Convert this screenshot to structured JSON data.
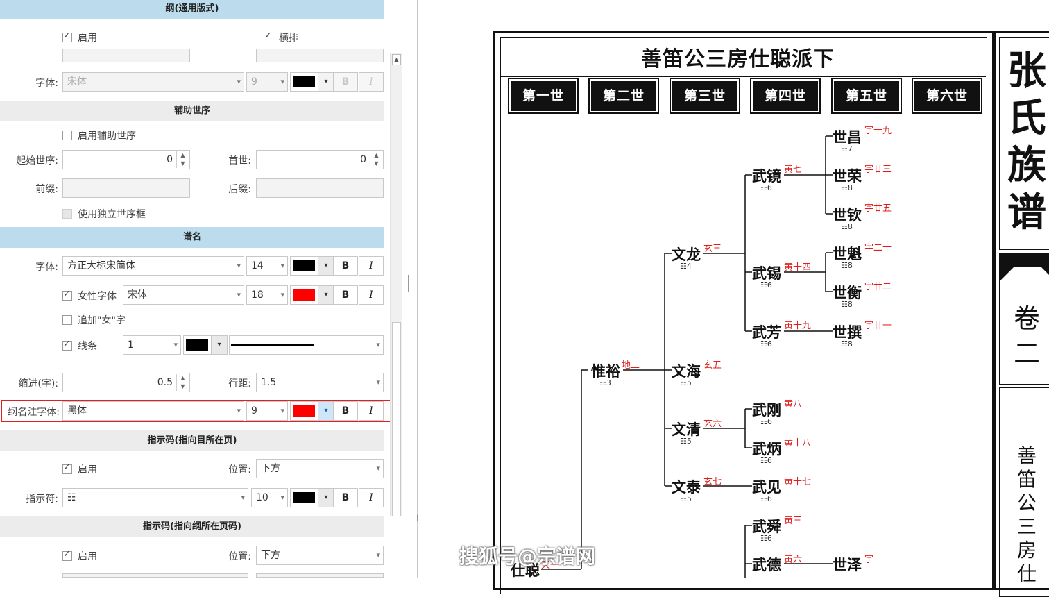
{
  "settings_panel": {
    "section_outline": "纲(通用版式)",
    "outline_enabled_label": "启用",
    "outline_horizontal_label": "横排",
    "outline_font_label": "字体:",
    "outline_font_value": "宋体",
    "outline_font_size": "9",
    "section_aux_gen": "辅助世序",
    "aux_enable_label": "启用辅助世序",
    "start_gen_label": "起始世序:",
    "start_gen_value": "0",
    "first_gen_label": "首世:",
    "first_gen_value": "0",
    "prefix_label": "前缀:",
    "suffix_label": "后缀:",
    "independent_box_label": "使用独立世序框",
    "section_name": "谱名",
    "name_font_label": "字体:",
    "name_font_value": "方正大标宋简体",
    "name_font_size": "14",
    "female_font_label": "女性字体",
    "female_font_value": "宋体",
    "female_font_size": "18",
    "add_female_label": "追加\"女\"字",
    "line_label": "线条",
    "line_width_value": "1",
    "indent_label": "缩进(字):",
    "indent_value": "0.5",
    "line_spacing_label": "行距:",
    "line_spacing_value": "1.5",
    "annotation_font_label": "纲名注字体:",
    "annotation_font_value": "黑体",
    "annotation_font_size": "9",
    "section_pointer_page": "指示码(指向目所在页)",
    "pointer_enable_label": "启用",
    "position_label": "位置:",
    "position_value": "下方",
    "pointer_char_label": "指示符:",
    "pointer_char_value": "☷",
    "pointer_size": "10",
    "section_pointer_outline": "指示码(指向纲所在页码)",
    "pointer2_enable_label": "启用",
    "position2_label": "位置:",
    "position2_value": "下方",
    "bold_label": "B",
    "italic_label": "I",
    "colors": {
      "black": "#000000",
      "red": "#ff0000",
      "section_blue": "#bcdcee",
      "highlight": "#e02020"
    }
  },
  "genealogy": {
    "header_title": "善笛公三房仕聪派下",
    "book_title_chars": [
      "张",
      "氏",
      "族",
      "谱"
    ],
    "volume_chars": [
      "卷",
      "二"
    ],
    "side_chars": [
      "善",
      "笛",
      "公",
      "三",
      "房",
      "仕"
    ],
    "generations": [
      "第一世",
      "第二世",
      "第三世",
      "第四世",
      "第五世",
      "第六世"
    ],
    "persons": [
      {
        "name": "仕聪",
        "note": "天一",
        "code": ""
      },
      {
        "name": "惟裕",
        "note": "地二",
        "code": "3"
      },
      {
        "name": "文龙",
        "note": "玄三",
        "code": "4"
      },
      {
        "name": "文海",
        "note": "玄五",
        "code": "5"
      },
      {
        "name": "文清",
        "note": "玄六",
        "code": "5"
      },
      {
        "name": "文泰",
        "note": "玄七",
        "code": "5"
      },
      {
        "name": "武镜",
        "note": "黄七",
        "code": "6"
      },
      {
        "name": "武锡",
        "note": "黄十四",
        "code": "6"
      },
      {
        "name": "武芳",
        "note": "黄十九",
        "code": "6"
      },
      {
        "name": "武刚",
        "note": "黄八",
        "code": "6"
      },
      {
        "name": "武炳",
        "note": "黄十八",
        "code": "6"
      },
      {
        "name": "武见",
        "note": "黄十七",
        "code": "6"
      },
      {
        "name": "武舜",
        "note": "黄三",
        "code": "6"
      },
      {
        "name": "武德",
        "note": "黄六",
        "code": ""
      },
      {
        "name": "世昌",
        "note": "宇十九",
        "code": "7"
      },
      {
        "name": "世荣",
        "note": "宇廿三",
        "code": "8"
      },
      {
        "name": "世钦",
        "note": "宇廿五",
        "code": "8"
      },
      {
        "name": "世魁",
        "note": "宇二十",
        "code": "8"
      },
      {
        "name": "世衡",
        "note": "宇廿二",
        "code": "8"
      },
      {
        "name": "世撰",
        "note": "宇廿一",
        "code": "8"
      },
      {
        "name": "世泽",
        "note": "宇",
        "code": ""
      }
    ],
    "code_glyph": "☷"
  },
  "watermark": "搜狐号@宗谱网"
}
